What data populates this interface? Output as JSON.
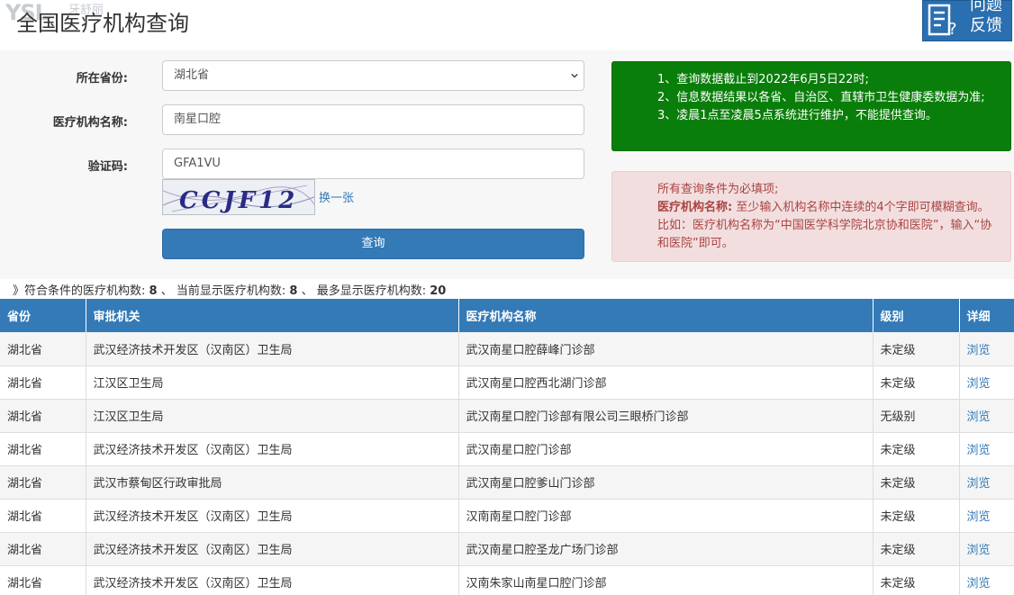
{
  "header": {
    "title": "全国医疗机构查询",
    "watermark": "YSL",
    "watermark_sub": "牙舒丽",
    "feedback_line1": "问题",
    "feedback_line2": "反馈"
  },
  "form": {
    "province_label": "所在省份:",
    "province_value": "湖北省",
    "org_name_label": "医疗机构名称:",
    "org_name_value": "南星口腔",
    "captcha_label": "验证码:",
    "captcha_value": "GFA1VU",
    "captcha_image_text": "CCJF12",
    "change_captcha": "换一张",
    "submit_label": "查询"
  },
  "notices": {
    "green": [
      "1、查询数据截止到2022年6月5日22时;",
      "2、信息数据结果以各省、自治区、直辖市卫生健康委数据为准;",
      "3、凌晨1点至凌晨5点系统进行维护，不能提供查询。"
    ],
    "red_line1": "所有查询条件为必填项;",
    "red_bold": "医疗机构名称:",
    "red_rest": " 至少输入机构名称中连续的4个字即可模糊查询。比如：医疗机构名称为“中国医学科学院北京协和医院”，输入“协和医院”即可。"
  },
  "summary": {
    "prefix": "》符合条件的医疗机构数:",
    "matched": "8",
    "sep1": "、 当前显示医疗机构数:",
    "shown": "8",
    "sep2": "、 最多显示医疗机构数:",
    "max": "20"
  },
  "table": {
    "headers": [
      "省份",
      "审批机关",
      "医疗机构名称",
      "级别",
      "详细"
    ],
    "rows": [
      [
        "湖北省",
        "武汉经济技术开发区（汉南区）卫生局",
        "武汉南星口腔薛峰门诊部",
        "未定级",
        "浏览"
      ],
      [
        "湖北省",
        "江汉区卫生局",
        "武汉南星口腔西北湖门诊部",
        "未定级",
        "浏览"
      ],
      [
        "湖北省",
        "江汉区卫生局",
        "武汉南星口腔门诊部有限公司三眼桥门诊部",
        "无级别",
        "浏览"
      ],
      [
        "湖北省",
        "武汉经济技术开发区（汉南区）卫生局",
        "武汉南星口腔门诊部",
        "未定级",
        "浏览"
      ],
      [
        "湖北省",
        "武汉市蔡甸区行政审批局",
        "武汉南星口腔爹山门诊部",
        "未定级",
        "浏览"
      ],
      [
        "湖北省",
        "武汉经济技术开发区（汉南区）卫生局",
        "汉南南星口腔门诊部",
        "未定级",
        "浏览"
      ],
      [
        "湖北省",
        "武汉经济技术开发区（汉南区）卫生局",
        "武汉南星口腔圣龙广场门诊部",
        "未定级",
        "浏览"
      ],
      [
        "湖北省",
        "武汉经济技术开发区（汉南区）卫生局",
        "汉南朱家山南星口腔门诊部",
        "未定级",
        "浏览"
      ]
    ]
  },
  "colors": {
    "primary": "#337ab7",
    "notice_green": "#0a7e0a",
    "notice_red_bg": "#f2dede",
    "notice_red_text": "#a94442"
  }
}
